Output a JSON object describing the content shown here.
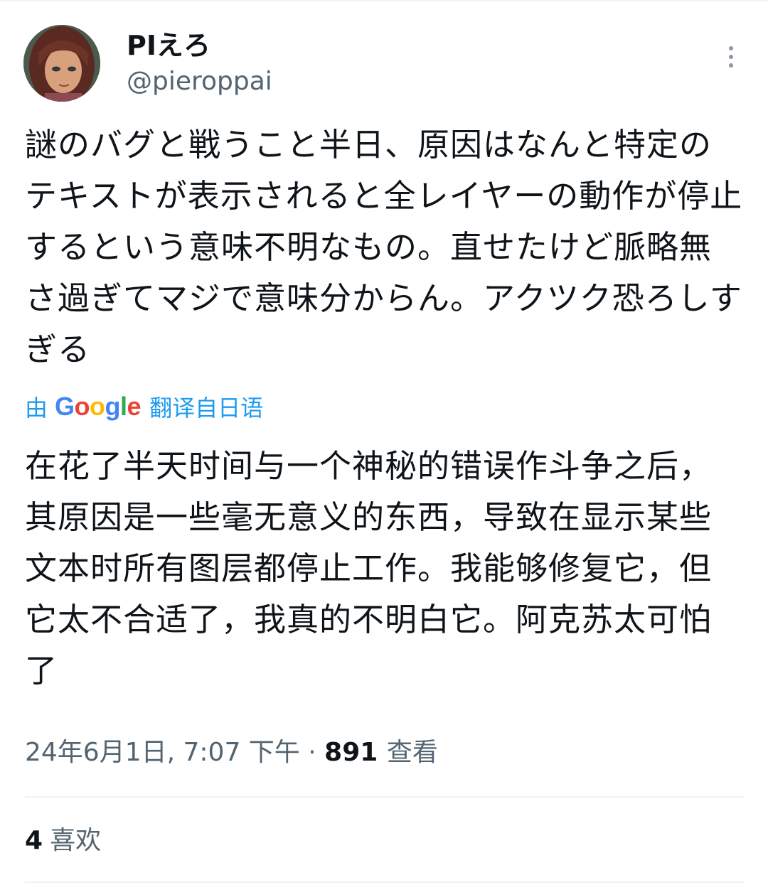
{
  "author": {
    "display_name": "PIえろ",
    "handle": "@pieroppai"
  },
  "tweet": {
    "text": "謎のバグと戦うこと半日、原因はなんと特定のテキストが表示されると全レイヤーの動作が停止するという意味不明なもの。直せたけど脈略無さ過ぎてマジで意味分からん。アクツク恐ろしすぎる",
    "translation_prefix": "由",
    "translation_brand": "Google",
    "translation_suffix": "翻译自日语",
    "translated_text": "在花了半天时间与一个神秘的错误作斗争之后，其原因是一些毫无意义的东西，导致在显示某些文本时所有图层都停止工作。我能够修复它，但它太不合适了，我真的不明白它。阿克苏太可怕了",
    "timestamp": "24年6月1日, 7:07 下午",
    "separator": "·",
    "views_count": "891",
    "views_label": "查看",
    "likes_count": "4",
    "likes_label": "喜欢"
  },
  "icons": {
    "more": "more-vertical-icon",
    "avatar": "avatar-image"
  },
  "colors": {
    "link_blue": "#1d9bf0",
    "secondary_text": "#536471",
    "primary_text": "#0f1419",
    "divider": "#eff3f4",
    "google_blue": "#4285F4",
    "google_red": "#EA4335",
    "google_yellow": "#FBBC05",
    "google_green": "#34A853"
  }
}
